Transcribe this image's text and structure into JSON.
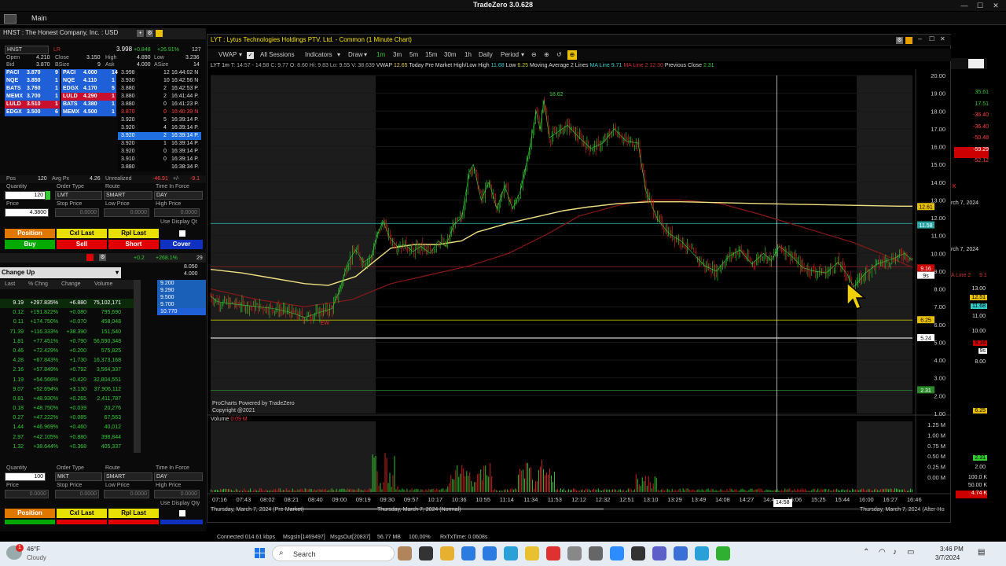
{
  "app": {
    "title": "TradeZero 3.0.628",
    "menu_main": "Main"
  },
  "left": {
    "header": "HNST : The Honest Company, Inc. : USD",
    "symbol": "HNST",
    "lr": "LR",
    "last": "3.998",
    "chg": "+0.848",
    "chg_pct": "+26.91%",
    "chg_extra": "127",
    "open_l": "Open",
    "open_v": "4.210",
    "close_l": "Close",
    "close_v": "3.150",
    "high_l": "High",
    "high_v": "4.890",
    "low_l": "Low",
    "low_v": "3.236",
    "bid_l": "Bid",
    "bid_v": "3.870",
    "bsize_l": "BSize",
    "bsize_v": "9",
    "ask_l": "Ask",
    "ask_v": "4.000",
    "asize_l": "ASize",
    "asize_v": "14",
    "level2": [
      {
        "bmm": "PACI",
        "bp": "3.870",
        "bs": "9",
        "amm": "PACI",
        "ap": "4.000",
        "as": "14",
        "bc": "#1f5fd8",
        "ac": "#1f5fd8"
      },
      {
        "bmm": "NQE",
        "bp": "3.850",
        "bs": "1",
        "amm": "NQE",
        "ap": "4.110",
        "as": "1",
        "bc": "#1f5fd8",
        "ac": "#1f5fd8"
      },
      {
        "bmm": "BATS",
        "bp": "3.760",
        "bs": "1",
        "amm": "EDGX",
        "ap": "4.170",
        "as": "5",
        "bc": "#1f5fd8",
        "ac": "#1f5fd8"
      },
      {
        "bmm": "MEMX",
        "bp": "3.700",
        "bs": "1",
        "amm": "LULD",
        "ap": "4.290",
        "as": "1",
        "bc": "#1f5fd8",
        "ac": "#c8102e"
      },
      {
        "bmm": "LULD",
        "bp": "3.510",
        "bs": "1",
        "amm": "BATS",
        "ap": "4.380",
        "as": "1",
        "bc": "#c8102e",
        "ac": "#1f5fd8"
      },
      {
        "bmm": "EDGX",
        "bp": "3.500",
        "bs": "6",
        "amm": "MEMX",
        "ap": "4.500",
        "as": "1",
        "bc": "#1f5fd8",
        "ac": "#1f5fd8"
      }
    ],
    "ts": [
      {
        "p": "3.998",
        "s": "12",
        "t": "16:44:02 N",
        "c": "#ddd"
      },
      {
        "p": "3.930",
        "s": "10",
        "t": "16:42:56 N",
        "c": "#ddd"
      },
      {
        "p": "3.880",
        "s": "2",
        "t": "16:42:53 P.",
        "c": "#ddd"
      },
      {
        "p": "3.880",
        "s": "2",
        "t": "16:41:44 P.",
        "c": "#ddd"
      },
      {
        "p": "3.880",
        "s": "0",
        "t": "16:41:23 P.",
        "c": "#ddd"
      },
      {
        "p": "3.870",
        "s": "0",
        "t": "16:40:39 N",
        "c": "#ff4040"
      },
      {
        "p": "3.920",
        "s": "5",
        "t": "16:39:14 P.",
        "c": "#ddd"
      },
      {
        "p": "3.920",
        "s": "4",
        "t": "16:39:14 P.",
        "c": "#ddd"
      },
      {
        "p": "3.920",
        "s": "2",
        "t": "16:39:14 P.",
        "c": "#fff",
        "hl": true
      },
      {
        "p": "3.920",
        "s": "1",
        "t": "16:39:14 P.",
        "c": "#ddd"
      },
      {
        "p": "3.920",
        "s": "0",
        "t": "16:39:14 P.",
        "c": "#ddd"
      },
      {
        "p": "3.910",
        "s": "0",
        "t": "16:39:14 P.",
        "c": "#ddd"
      },
      {
        "p": "3.880",
        "s": "",
        "t": "16:38:34 P.",
        "c": "#ddd"
      }
    ],
    "pos_l": "Pos",
    "pos_v": "120",
    "avgpx_l": "Avg Px",
    "avgpx_v": "4.26",
    "unreal_l": "Unrealized",
    "unreal_v": "-46.91",
    "unreal_x": "+/-",
    "unreal_x2": "-9.1",
    "o1": {
      "qty_l": "Quantity",
      "qty": "120",
      "otype_l": "Order Type",
      "otype": "LMT",
      "route_l": "Route",
      "route": "SMART",
      "tif_l": "Time In Force",
      "tif": "DAY",
      "price_l": "Price",
      "price": "4.3800",
      "stop_l": "Stop Price",
      "stop": "0.0000",
      "lowp_l": "Low Price",
      "lowp": "0.0000",
      "highp_l": "High Price",
      "highp": "0.0000",
      "disp": "Use Display Qt"
    },
    "btns1": {
      "position": "Position",
      "cxl": "Cxl Last",
      "rpl": "Rpl Last",
      "buy": "Buy",
      "sell": "Sell",
      "short": "Short",
      "cover": "Cover"
    },
    "mini": {
      "chg": "+0.2",
      "chg2": "+268.1%",
      "v": "29",
      "v2": "8.050",
      "v3": "4.000",
      "lvls": [
        "9.200",
        "9.290",
        "9.500",
        "9.700",
        "10.770"
      ]
    },
    "scanner": {
      "title": "Change Up",
      "h_last": "Last",
      "h_pct": "% Chng",
      "h_chg": "Change",
      "h_vol": "Volume",
      "rows": [
        {
          "l": "9.19",
          "p": "+297.835%",
          "c": "+6.880",
          "v": "75,102,171",
          "hl": true
        },
        {
          "l": "0.12",
          "p": "+191.822%",
          "c": "+0.080",
          "v": "795,690"
        },
        {
          "l": "0.11",
          "p": "+174.750%",
          "c": "+0.070",
          "v": "458,048"
        },
        {
          "l": "71.39",
          "p": "+116.333%",
          "c": "+38.390",
          "v": "151,540"
        },
        {
          "l": "1.81",
          "p": "+77.451%",
          "c": "+0.790",
          "v": "56,590,348"
        },
        {
          "l": "0.46",
          "p": "+72.429%",
          "c": "+0.200",
          "v": "575,825"
        },
        {
          "l": "4.28",
          "p": "+67.843%",
          "c": "+1.730",
          "v": "16,373,168"
        },
        {
          "l": "2.16",
          "p": "+57.849%",
          "c": "+0.792",
          "v": "3,564,337"
        },
        {
          "l": "1.19",
          "p": "+54.566%",
          "c": "+0.420",
          "v": "32,804,551"
        },
        {
          "l": "9.07",
          "p": "+52.694%",
          "c": "+3.130",
          "v": "37,906,112"
        },
        {
          "l": "0.81",
          "p": "+48.930%",
          "c": "+0.265",
          "v": "2,411,787"
        },
        {
          "l": "0.18",
          "p": "+48.750%",
          "c": "+0.039",
          "v": "20,276"
        },
        {
          "l": "0.27",
          "p": "+47.222%",
          "c": "+0.085",
          "v": "67,563"
        },
        {
          "l": "1.44",
          "p": "+46.969%",
          "c": "+0.460",
          "v": "40,012"
        },
        {
          "l": "2.97",
          "p": "+42.105%",
          "c": "+0.880",
          "v": "398,844"
        },
        {
          "l": "1.32",
          "p": "+38.644%",
          "c": "+0.368",
          "v": "405,337"
        }
      ]
    },
    "o2": {
      "qty_l": "Quantity",
      "qty": "100",
      "otype_l": "Order Type",
      "otype": "MKT",
      "route_l": "Route",
      "route": "SMART",
      "tif_l": "Time In Force",
      "tif": "DAY",
      "price_l": "Price",
      "price": "0.0000",
      "stop_l": "Stop Price",
      "stop": "0.0000",
      "lowp_l": "Low Price",
      "lowp": "0.0000",
      "highp_l": "High Price",
      "highp": "0.0000",
      "disp": "Use Display Qty"
    },
    "btns2": {
      "position": "Position",
      "cxl": "Cxl Last",
      "rpl": "Rpl Last"
    }
  },
  "chart": {
    "title": "LYT : Lytus Technologies Holdings PTV. Ltd. - Common (1 Minute Chart)",
    "toolbar": {
      "vwap": "VWAP",
      "allsessions": "All Sessions",
      "indicators": "Indicators",
      "draw": "Draw",
      "t1": "1m",
      "t3": "3m",
      "t5": "5m",
      "t15": "15m",
      "t30": "30m",
      "th": "1h",
      "td": "Daily",
      "period": "Period"
    },
    "info": {
      "sym": "LYT 1m",
      "t": "T: 14:57 - 14:58",
      "c": "C: 9.77",
      "o": "O: 8.60",
      "h": "Hi: 9.83",
      "lo": "Lo: 9.55",
      "v": "V: 38,639",
      "vwap_l": "VWAP",
      "vwap_v": "12.65",
      "pm_l": "Today Pre Market High/Low",
      "high_l": "High",
      "high_v": "11.68",
      "low_l": "Low",
      "low_v": "6.25",
      "ma_l": "Moving Average 2 Lines",
      "ma1_l": "MA Line",
      "ma1_v": "9.71",
      "ma2_l": "MA Line 2",
      "ma2_v": "12.30",
      "prev_l": "Previous Close",
      "prev_v": "2.31"
    },
    "credit1": "ProCharts Powered by TradeZero",
    "credit2": "Copyright @2021",
    "vol_l": "Volume",
    "vol_v": "0.09 M",
    "peak_label": "18.62",
    "low_label": "6.25",
    "crosshair_time": "14:58",
    "sessions": [
      "Thursday, March 7, 2024 (Pre-Market)",
      "Thursday, March 7, 2024 (Normal)",
      "Thursday, March 7, 2024 (After-Ho"
    ]
  },
  "chart_data": {
    "type": "line",
    "y_ticks": [
      "20.00",
      "19.00",
      "18.00",
      "17.00",
      "16.00",
      "15.00",
      "14.00",
      "13.00",
      "12.00",
      "11.00",
      "10.00",
      "9.00",
      "8.00",
      "7.00",
      "6.00",
      "5.00",
      "4.00",
      "3.00",
      "2.00",
      "1.00"
    ],
    "x_ticks": [
      "07:16",
      "07:43",
      "08:02",
      "08:21",
      "08:40",
      "09:00",
      "09:19",
      "09:30",
      "09:57",
      "10:17",
      "10:36",
      "10:55",
      "11:14",
      "11:34",
      "11:53",
      "12:12",
      "12:32",
      "12:51",
      "13:10",
      "13:29",
      "13:49",
      "14:08",
      "14:27",
      "14:4",
      "15:06",
      "15:25",
      "15:44",
      "16:00",
      "16:27",
      "16:46"
    ],
    "vol_ticks": [
      "1.25 M",
      "1.00 M",
      "0.75 M",
      "0.50 M",
      "0.25 M",
      "0.00 M"
    ],
    "ylim": [
      1,
      20
    ],
    "price": [
      [
        0,
        7.6
      ],
      [
        8,
        7.3
      ],
      [
        20,
        7.2
      ],
      [
        40,
        7.1
      ],
      [
        60,
        7.0
      ],
      [
        80,
        6.9
      ],
      [
        100,
        6.7
      ],
      [
        120,
        6.4
      ],
      [
        140,
        6.7
      ],
      [
        155,
        6.9
      ],
      [
        165,
        8.0
      ],
      [
        175,
        9.5
      ],
      [
        185,
        10.2
      ],
      [
        195,
        9.5
      ],
      [
        205,
        9.8
      ],
      [
        212,
        11.0
      ],
      [
        220,
        11.8
      ],
      [
        228,
        10.9
      ],
      [
        238,
        10.4
      ],
      [
        248,
        10.5
      ],
      [
        258,
        10.1
      ],
      [
        268,
        10.4
      ],
      [
        280,
        10.0
      ],
      [
        290,
        10.7
      ],
      [
        300,
        10.4
      ],
      [
        310,
        11.6
      ],
      [
        320,
        12.0
      ],
      [
        330,
        14.6
      ],
      [
        335,
        15.0
      ],
      [
        345,
        13.0
      ],
      [
        355,
        14.0
      ],
      [
        365,
        12.5
      ],
      [
        375,
        13.8
      ],
      [
        385,
        12.5
      ],
      [
        395,
        13.5
      ],
      [
        405,
        15.5
      ],
      [
        415,
        18.0
      ],
      [
        420,
        17.0
      ],
      [
        425,
        18.6
      ],
      [
        432,
        16.5
      ],
      [
        442,
        16.8
      ],
      [
        455,
        17.2
      ],
      [
        470,
        16.5
      ],
      [
        485,
        15.9
      ],
      [
        500,
        16.2
      ],
      [
        515,
        17.0
      ],
      [
        530,
        16.3
      ],
      [
        545,
        16.2
      ],
      [
        555,
        13.5
      ],
      [
        570,
        11.9
      ],
      [
        585,
        11.1
      ],
      [
        600,
        10.7
      ],
      [
        615,
        10.0
      ],
      [
        630,
        9.3
      ],
      [
        645,
        9.0
      ],
      [
        660,
        9.8
      ],
      [
        675,
        10.2
      ],
      [
        690,
        9.4
      ],
      [
        705,
        10.0
      ],
      [
        715,
        9.6
      ],
      [
        725,
        10.4
      ],
      [
        740,
        9.9
      ],
      [
        755,
        9.2
      ],
      [
        770,
        9.0
      ],
      [
        785,
        8.9
      ],
      [
        800,
        9.5
      ],
      [
        812,
        8.8
      ],
      [
        820,
        8.1
      ],
      [
        835,
        8.9
      ],
      [
        850,
        9.4
      ],
      [
        870,
        9.7
      ],
      [
        885,
        10.0
      ],
      [
        895,
        9.6
      ]
    ],
    "vwap": [
      [
        0,
        9.1
      ],
      [
        40,
        8.9
      ],
      [
        80,
        8.6
      ],
      [
        120,
        8.3
      ],
      [
        150,
        8.2
      ],
      [
        185,
        8.7
      ],
      [
        210,
        9.6
      ],
      [
        230,
        10.3
      ],
      [
        260,
        10.5
      ],
      [
        290,
        10.5
      ],
      [
        320,
        10.7
      ],
      [
        340,
        11.2
      ],
      [
        380,
        11.7
      ],
      [
        420,
        12.1
      ],
      [
        450,
        12.4
      ],
      [
        480,
        12.6
      ],
      [
        520,
        12.8
      ],
      [
        560,
        12.9
      ],
      [
        600,
        12.9
      ],
      [
        650,
        12.85
      ],
      [
        700,
        12.8
      ],
      [
        760,
        12.75
      ],
      [
        820,
        12.7
      ],
      [
        880,
        12.65
      ],
      [
        895,
        12.65
      ]
    ],
    "ma1": [
      [
        0,
        8.0
      ],
      [
        60,
        7.4
      ],
      [
        120,
        7.0
      ],
      [
        180,
        7.4
      ],
      [
        230,
        8.3
      ],
      [
        280,
        8.8
      ],
      [
        330,
        9.3
      ],
      [
        380,
        10.0
      ],
      [
        430,
        11.1
      ],
      [
        470,
        12.1
      ],
      [
        520,
        12.7
      ],
      [
        560,
        13.0
      ],
      [
        600,
        13.0
      ],
      [
        650,
        12.8
      ],
      [
        700,
        12.2
      ],
      [
        760,
        11.4
      ],
      [
        820,
        10.6
      ],
      [
        860,
        9.9
      ],
      [
        895,
        9.2
      ]
    ],
    "levels": {
      "high": 11.68,
      "low": 6.25,
      "prev": 2.31,
      "white": 5.24,
      "ma2": 12.3
    }
  },
  "right": {
    "vals": [
      "35.61",
      "17.51",
      "-36.40",
      "-36.40",
      "-50.48",
      "-59.29",
      "-52.12"
    ],
    "date": "rch 7, 2024",
    "date2": "rch 7, 2024",
    "ma2": "A Line 2",
    "ma2v": "9.1",
    "axis": [
      "13.00",
      "12.51",
      "11.68",
      "11.00",
      "10.00",
      "9.16",
      "9s",
      "8.00",
      "6.25",
      "2.31",
      "2.00"
    ],
    "vol": [
      "100.0 K",
      "50.00 K",
      "4.74 K"
    ]
  },
  "overlay_badges": {
    "b1": "12.61",
    "b2": "11.58",
    "b3": "9.16",
    "b4": "9s",
    "b5": "6.25",
    "b6": "5.24",
    "b7": "2.31"
  },
  "status": {
    "conn": "Connected 014.61 kbps",
    "msgsin": "MsgsIn[1469497]",
    "msgsout": "MsgsOut[20837]",
    "mem": "56.77 MB",
    "pct": "100.00%",
    "rx": "RxTxTime: 0.0608s"
  },
  "taskbar": {
    "temp": "46°F",
    "weather": "Cloudy",
    "search": "Search",
    "time": "3:46 PM",
    "date": "3/7/2024",
    "badge": "1"
  }
}
